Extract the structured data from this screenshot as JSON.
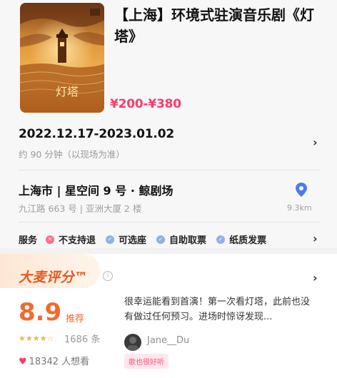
{
  "show": {
    "title": "【上海】环境式驻演音乐剧《灯塔》",
    "price": "¥200-¥380",
    "poster_text": "灯塔"
  },
  "schedule": {
    "date_range": "2022.12.17-2023.01.02",
    "duration": "约 90 分钟（以现场为准）"
  },
  "venue": {
    "name": "上海市 | 星空间 9 号 · 鲸剧场",
    "address": "九江路 663 号 | 亚洲大厦 2 楼",
    "distance": "9.3km"
  },
  "services": {
    "label": "服务",
    "items": [
      {
        "label": "不支持退",
        "status": "no"
      },
      {
        "label": "可选座",
        "status": "yes"
      },
      {
        "label": "自助取票",
        "status": "yes"
      },
      {
        "label": "纸质发票",
        "status": "yes"
      }
    ]
  },
  "rating": {
    "brand": "大麦评分™",
    "score": "8.9",
    "score_tag": "推荐",
    "stars": "★★★★☆",
    "count": "1686 条",
    "want": "18342 人想看"
  },
  "review": {
    "text": "很幸运能看到首演！第一次看灯塔，此前也没有做过任何预习。进场时惊讶发现...",
    "author": "Jane__Du",
    "tag": "歌也很好听"
  },
  "colors": {
    "accent_pink": "#ff3b6b",
    "brand_orange": "#e8561c",
    "score_orange": "#f26a2e"
  }
}
